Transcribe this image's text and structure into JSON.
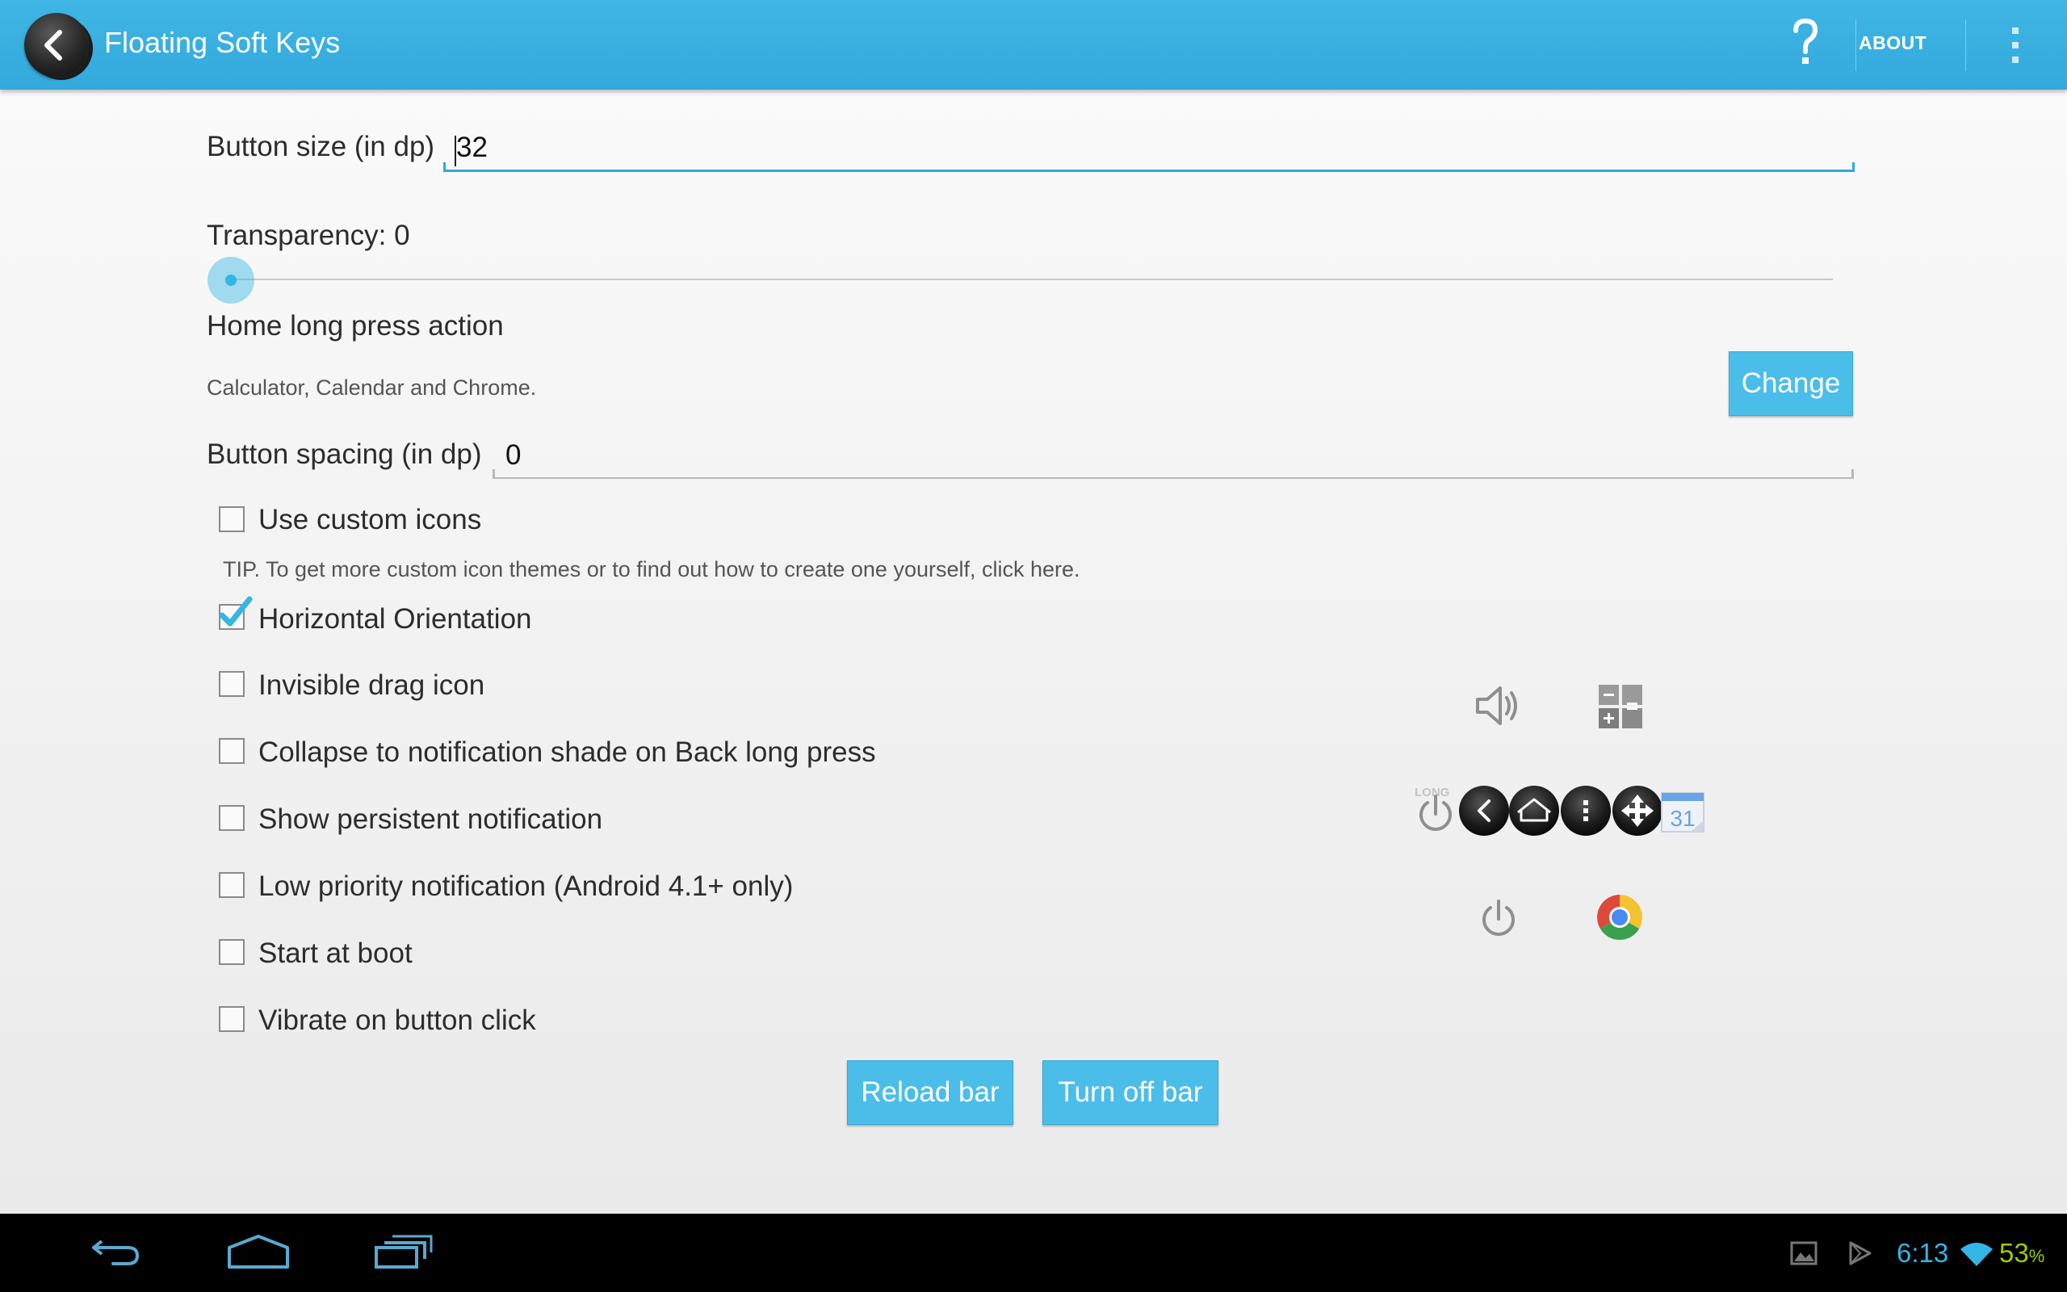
{
  "action_bar": {
    "title": "Floating Soft Keys",
    "help_label": "?",
    "about_label": "ABOUT"
  },
  "settings": {
    "button_size": {
      "label": "Button size (in dp)",
      "value": "32"
    },
    "transparency": {
      "label": "Transparency: 0",
      "value": 0
    },
    "home_long_press": {
      "label": "Home long press action",
      "summary": "Calculator, Calendar and Chrome.",
      "change_label": "Change"
    },
    "button_spacing": {
      "label": "Button spacing (in dp)",
      "value": "0"
    },
    "use_custom_icons": {
      "label": "Use custom icons",
      "checked": false
    },
    "tip": "TIP. To get more custom icon themes or to find out how to create one yourself, click here.",
    "horizontal_orientation": {
      "label": "Horizontal Orientation",
      "checked": true
    },
    "invisible_drag_icon": {
      "label": "Invisible drag icon",
      "checked": false
    },
    "collapse_notification": {
      "label": "Collapse to notification shade on Back long press",
      "checked": false
    },
    "persistent_notification": {
      "label": "Show persistent notification",
      "checked": false
    },
    "low_priority_notification": {
      "label": "Low priority notification (Android 4.1+ only)",
      "checked": false
    },
    "start_at_boot": {
      "label": "Start at boot",
      "checked": false
    },
    "vibrate_on_click": {
      "label": "Vibrate on button click",
      "checked": false
    }
  },
  "actions": {
    "reload_label": "Reload bar",
    "turn_off_label": "Turn off bar"
  },
  "preview": {
    "long_label": "LONG",
    "calendar_day": "31",
    "icons": [
      "volume-icon",
      "calculator-icon",
      "power-icon",
      "back-icon",
      "home-icon",
      "menu-icon",
      "move-icon",
      "calendar-icon",
      "power-icon",
      "chrome-icon"
    ]
  },
  "status_bar": {
    "time": "6:13",
    "battery": "53",
    "battery_unit": "%"
  },
  "colors": {
    "accent": "#33b5e5",
    "action_bar": "#3aafe2",
    "battery": "#99cc00"
  }
}
